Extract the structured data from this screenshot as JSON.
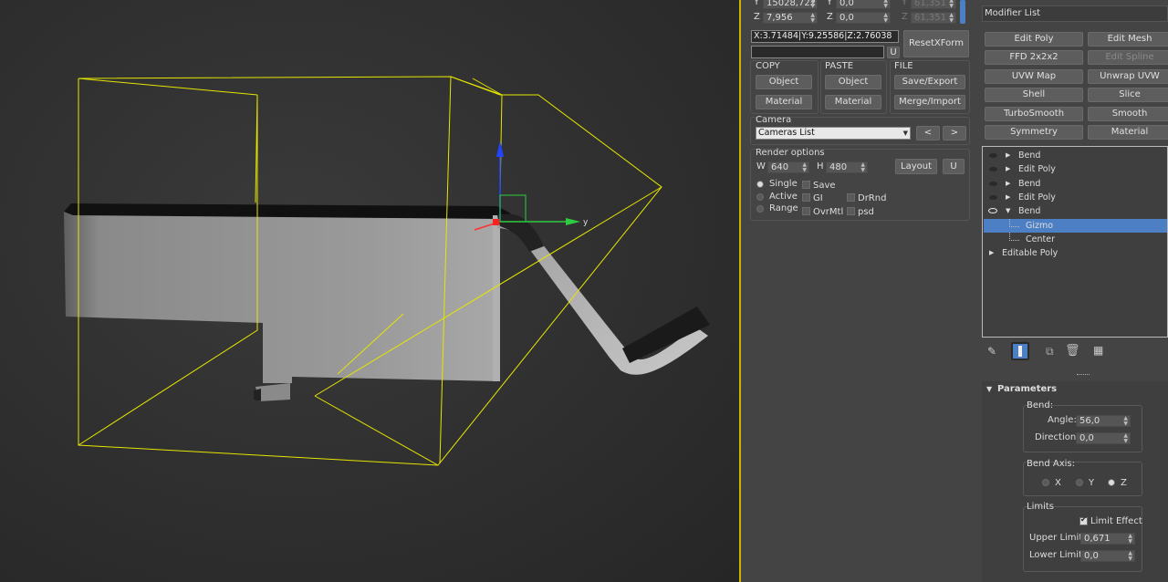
{
  "coords": {
    "y_label": "Y",
    "y_value": "15028,722",
    "y2_label": "Y",
    "y2_value": "0,0",
    "y3_label": "Y",
    "y3_value": "61,351",
    "z_label": "Z",
    "z_value": "7,956",
    "z2_label": "Z",
    "z2_value": "0,0",
    "z3_label": "Z",
    "z3_value": "61,351",
    "readout": "X:3.71484|Y:9.25586|Z:2.76038",
    "u_label": "U"
  },
  "toolbar": {
    "resetxform": "ResetXForm",
    "copy_title": "COPY",
    "paste_title": "PASTE",
    "file_title": "FILE",
    "copy_object": "Object",
    "copy_material": "Material",
    "paste_object": "Object",
    "paste_material": "Material",
    "save_export": "Save/Export",
    "merge_import": "Merge/Import"
  },
  "camera": {
    "title": "Camera",
    "selected": "Cameras List",
    "prev": "<",
    "next": ">"
  },
  "render": {
    "title": "Render options",
    "w_label": "W",
    "w_value": "640",
    "h_label": "H",
    "h_value": "480",
    "layout": "Layout",
    "u": "U",
    "single": "Single",
    "active": "Active",
    "range": "Range",
    "save": "Save",
    "gi": "GI",
    "ovrmtl": "OvrMtl",
    "drrnd": "DrRnd",
    "psd": "psd"
  },
  "modifier": {
    "list_label": "Modifier List",
    "buttons": [
      {
        "label": "Edit Poly",
        "enabled": true
      },
      {
        "label": "Edit Mesh",
        "enabled": true
      },
      {
        "label": "FFD 2x2x2",
        "enabled": true
      },
      {
        "label": "Edit Spline",
        "enabled": false
      },
      {
        "label": "UVW Map",
        "enabled": true
      },
      {
        "label": "Unwrap UVW",
        "enabled": true
      },
      {
        "label": "Shell",
        "enabled": true
      },
      {
        "label": "Slice",
        "enabled": true
      },
      {
        "label": "TurboSmooth",
        "enabled": true
      },
      {
        "label": "Smooth",
        "enabled": true
      },
      {
        "label": "Symmetry",
        "enabled": true
      },
      {
        "label": "Material",
        "enabled": true
      }
    ],
    "stack": [
      {
        "label": "Bend"
      },
      {
        "label": "Edit Poly"
      },
      {
        "label": "Bend"
      },
      {
        "label": "Edit Poly"
      },
      {
        "label": "Bend"
      },
      {
        "label": "Gizmo"
      },
      {
        "label": "Center"
      },
      {
        "label": "Editable Poly"
      }
    ]
  },
  "params": {
    "title": "Parameters",
    "bend_label": "Bend:",
    "angle_label": "Angle:",
    "angle_value": "56,0",
    "direction_label": "Direction:",
    "direction_value": "0,0",
    "axis_label": "Bend Axis:",
    "axis_x": "X",
    "axis_y": "Y",
    "axis_z": "Z",
    "limits_label": "Limits",
    "limit_effect": "Limit Effect",
    "upper_label": "Upper Limit:",
    "upper_value": "0,671",
    "lower_label": "Lower Limit:",
    "lower_value": "0,0"
  },
  "viewport": {
    "axis_y": "y"
  },
  "colors": {
    "selection": "#4d7fc4",
    "gizmo": "#e6e600",
    "panel": "#444444"
  }
}
